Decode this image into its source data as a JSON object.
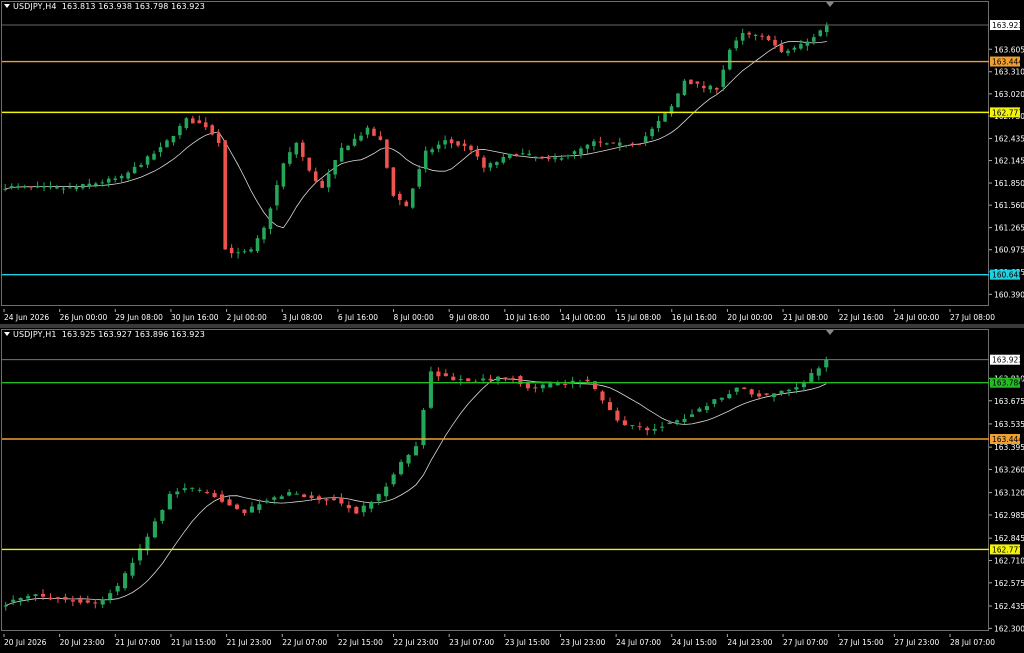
{
  "colors": {
    "bull": "#26a65b",
    "bear": "#ef5350",
    "ma": "#d8d8d8",
    "orange": "#f0a030",
    "yellow": "#f2f20a",
    "cyan": "#1fd0e0",
    "green": "#22bb22",
    "grid": "#777777"
  },
  "top_chart": {
    "header": "USDJPY,H4  163.813 163.938 163.798 163.923",
    "current_price": "163.923",
    "price_range": [
      160.25,
      164.12
    ],
    "levels": [
      {
        "price": 163.444,
        "label": "163.444",
        "color": "orange"
      },
      {
        "price": 162.777,
        "label": "162.777",
        "color": "yellow"
      },
      {
        "price": 160.648,
        "label": "160.648",
        "color": "cyan"
      }
    ],
    "y_ticks": [
      "163.605",
      "163.310",
      "163.020",
      "162.730",
      "162.435",
      "162.145",
      "161.850",
      "161.560",
      "161.265",
      "160.975",
      "160.685",
      "160.390"
    ],
    "x_ticks": [
      "24 Jun 2026",
      "26 Jun 00:00",
      "29 Jun 08:00",
      "30 Jun 16:00",
      "2 Jul 00:00",
      "3 Jul 08:00",
      "6 Jul 16:00",
      "8 Jul 00:00",
      "9 Jul 08:00",
      "10 Jul 16:00",
      "14 Jul 00:00",
      "15 Jul 08:00",
      "16 Jul 16:00",
      "20 Jul 00:00",
      "21 Jul 08:00",
      "22 Jul 16:00",
      "24 Jul 00:00",
      "27 Jul 08:00"
    ],
    "anchors": [
      [
        0,
        161.8
      ],
      [
        10,
        161.78
      ],
      [
        18,
        161.92
      ],
      [
        24,
        162.3
      ],
      [
        28,
        162.68
      ],
      [
        31,
        162.6
      ],
      [
        33,
        162.4
      ],
      [
        34,
        160.98
      ],
      [
        36,
        160.92
      ],
      [
        38,
        160.96
      ],
      [
        40,
        161.25
      ],
      [
        43,
        162.1
      ],
      [
        45,
        162.38
      ],
      [
        47,
        162.0
      ],
      [
        49,
        161.78
      ],
      [
        52,
        162.3
      ],
      [
        56,
        162.55
      ],
      [
        58,
        162.4
      ],
      [
        60,
        161.7
      ],
      [
        62,
        161.55
      ],
      [
        65,
        162.25
      ],
      [
        68,
        162.4
      ],
      [
        72,
        162.3
      ],
      [
        74,
        162.05
      ],
      [
        79,
        162.25
      ],
      [
        84,
        162.15
      ],
      [
        88,
        162.25
      ],
      [
        91,
        162.38
      ],
      [
        94,
        162.35
      ],
      [
        98,
        162.38
      ],
      [
        100,
        162.55
      ],
      [
        103,
        162.85
      ],
      [
        105,
        163.2
      ],
      [
        108,
        163.1
      ],
      [
        110,
        163.1
      ],
      [
        112,
        163.6
      ],
      [
        114,
        163.8
      ],
      [
        118,
        163.75
      ],
      [
        120,
        163.55
      ],
      [
        124,
        163.7
      ],
      [
        127,
        163.923
      ]
    ],
    "volatility_seed": 7
  },
  "bottom_chart": {
    "header": "USDJPY,H1  163.925 163.927 163.896 163.923",
    "current_price": "163.923",
    "price_range": [
      162.29,
      164.03
    ],
    "levels": [
      {
        "price": 163.784,
        "label": "163.784",
        "color": "green"
      },
      {
        "price": 163.444,
        "label": "163.444",
        "color": "orange"
      },
      {
        "price": 162.777,
        "label": "162.777",
        "color": "yellow"
      }
    ],
    "y_ticks": [
      "163.810",
      "163.675",
      "163.535",
      "163.395",
      "163.260",
      "163.120",
      "162.985",
      "162.845",
      "162.710",
      "162.575",
      "162.435",
      "162.300"
    ],
    "x_ticks": [
      "20 Jul 2026",
      "20 Jul 23:00",
      "21 Jul 07:00",
      "21 Jul 15:00",
      "21 Jul 23:00",
      "22 Jul 07:00",
      "22 Jul 15:00",
      "22 Jul 23:00",
      "23 Jul 07:00",
      "23 Jul 15:00",
      "23 Jul 23:00",
      "24 Jul 07:00",
      "24 Jul 15:00",
      "24 Jul 23:00",
      "27 Jul 07:00",
      "27 Jul 15:00",
      "27 Jul 23:00",
      "28 Jul 07:00"
    ],
    "anchors": [
      [
        0,
        162.45
      ],
      [
        4,
        162.5
      ],
      [
        12,
        162.45
      ],
      [
        15,
        162.55
      ],
      [
        17,
        162.7
      ],
      [
        22,
        163.1
      ],
      [
        24,
        163.15
      ],
      [
        28,
        163.1
      ],
      [
        30,
        163.05
      ],
      [
        32,
        163.0
      ],
      [
        34,
        163.05
      ],
      [
        38,
        163.12
      ],
      [
        42,
        163.08
      ],
      [
        44,
        163.08
      ],
      [
        47,
        163.0
      ],
      [
        50,
        163.1
      ],
      [
        53,
        163.3
      ],
      [
        55,
        163.4
      ],
      [
        57,
        163.85
      ],
      [
        60,
        163.8
      ],
      [
        64,
        163.8
      ],
      [
        68,
        163.82
      ],
      [
        70,
        163.75
      ],
      [
        74,
        163.78
      ],
      [
        78,
        163.8
      ],
      [
        82,
        163.55
      ],
      [
        86,
        163.5
      ],
      [
        90,
        163.55
      ],
      [
        94,
        163.65
      ],
      [
        98,
        163.75
      ],
      [
        102,
        163.7
      ],
      [
        106,
        163.75
      ],
      [
        110,
        163.923
      ]
    ],
    "volatility_seed": 13
  }
}
